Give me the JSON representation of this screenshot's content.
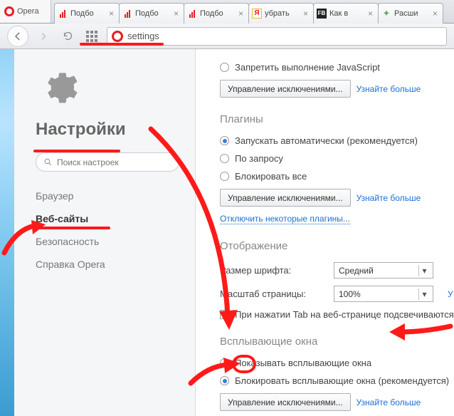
{
  "app_name": "Opera",
  "tabs": [
    {
      "label": "Подбо",
      "icon": "bars"
    },
    {
      "label": "Подбо",
      "icon": "bars"
    },
    {
      "label": "Подбо",
      "icon": "bars"
    },
    {
      "label": "убрать",
      "icon": "y"
    },
    {
      "label": "Как в",
      "icon": "fb"
    },
    {
      "label": "Расши",
      "icon": "puzzle"
    }
  ],
  "address_bar": "settings",
  "sidebar": {
    "title": "Настройки",
    "search_placeholder": "Поиск настроек",
    "items": [
      "Браузер",
      "Веб-сайты",
      "Безопасность",
      "Справка Opera"
    ],
    "active_index": 1
  },
  "content": {
    "js": {
      "block_label": "Запретить выполнение JavaScript",
      "manage_btn": "Управление исключениями...",
      "learn_more": "Узнайте больше"
    },
    "plugins": {
      "title": "Плагины",
      "opt_auto": "Запускать автоматически (рекомендуется)",
      "opt_request": "По запросу",
      "opt_block": "Блокировать все",
      "manage_btn": "Управление исключениями...",
      "learn_more": "Узнайте больше",
      "disable_link": "Отключить некоторые плагины..."
    },
    "display": {
      "title": "Отображение",
      "font_label": "Размер шрифта:",
      "font_value": "Средний",
      "zoom_label": "Масштаб страницы:",
      "zoom_value": "100%",
      "tab_highlight": "При нажатии Tab на веб-странице подсвечиваются",
      "learn_more_zoom": "У"
    },
    "popups": {
      "title": "Всплывающие окна",
      "opt_show": "Показывать всплывающие окна",
      "opt_block": "Блокировать всплывающие окна (рекомендуется)",
      "manage_btn": "Управление исключениями...",
      "learn_more": "Узнайте больше"
    }
  }
}
